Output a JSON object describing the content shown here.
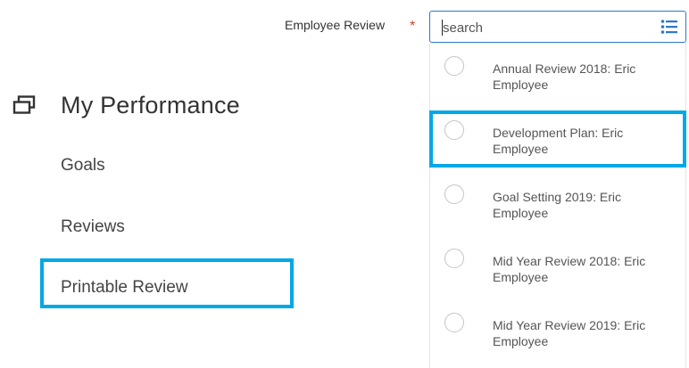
{
  "nav": {
    "title": "My Performance",
    "header_icon": "windows-icon",
    "items": [
      {
        "label": "Goals"
      },
      {
        "label": "Reviews"
      },
      {
        "label": "Printable Review",
        "highlighted": true
      }
    ]
  },
  "field": {
    "label": "Employee Review",
    "required_mark": "*",
    "search_placeholder": "search",
    "prompt_icon": "list-icon"
  },
  "dropdown": {
    "options": [
      {
        "label": "Annual Review 2018: Eric Employee",
        "selected": false
      },
      {
        "label": "Development Plan: Eric Employee",
        "selected": false,
        "highlighted": true
      },
      {
        "label": "Goal Setting 2019: Eric Employee",
        "selected": false
      },
      {
        "label": "Mid Year Review 2018: Eric Employee",
        "selected": false
      },
      {
        "label": "Mid Year Review 2019: Eric Employee",
        "selected": false
      }
    ]
  },
  "colors": {
    "highlight": "#00a8e6",
    "required": "#de3a2d",
    "input_border": "#2d78c8",
    "icon_blue": "#2d78c8"
  }
}
